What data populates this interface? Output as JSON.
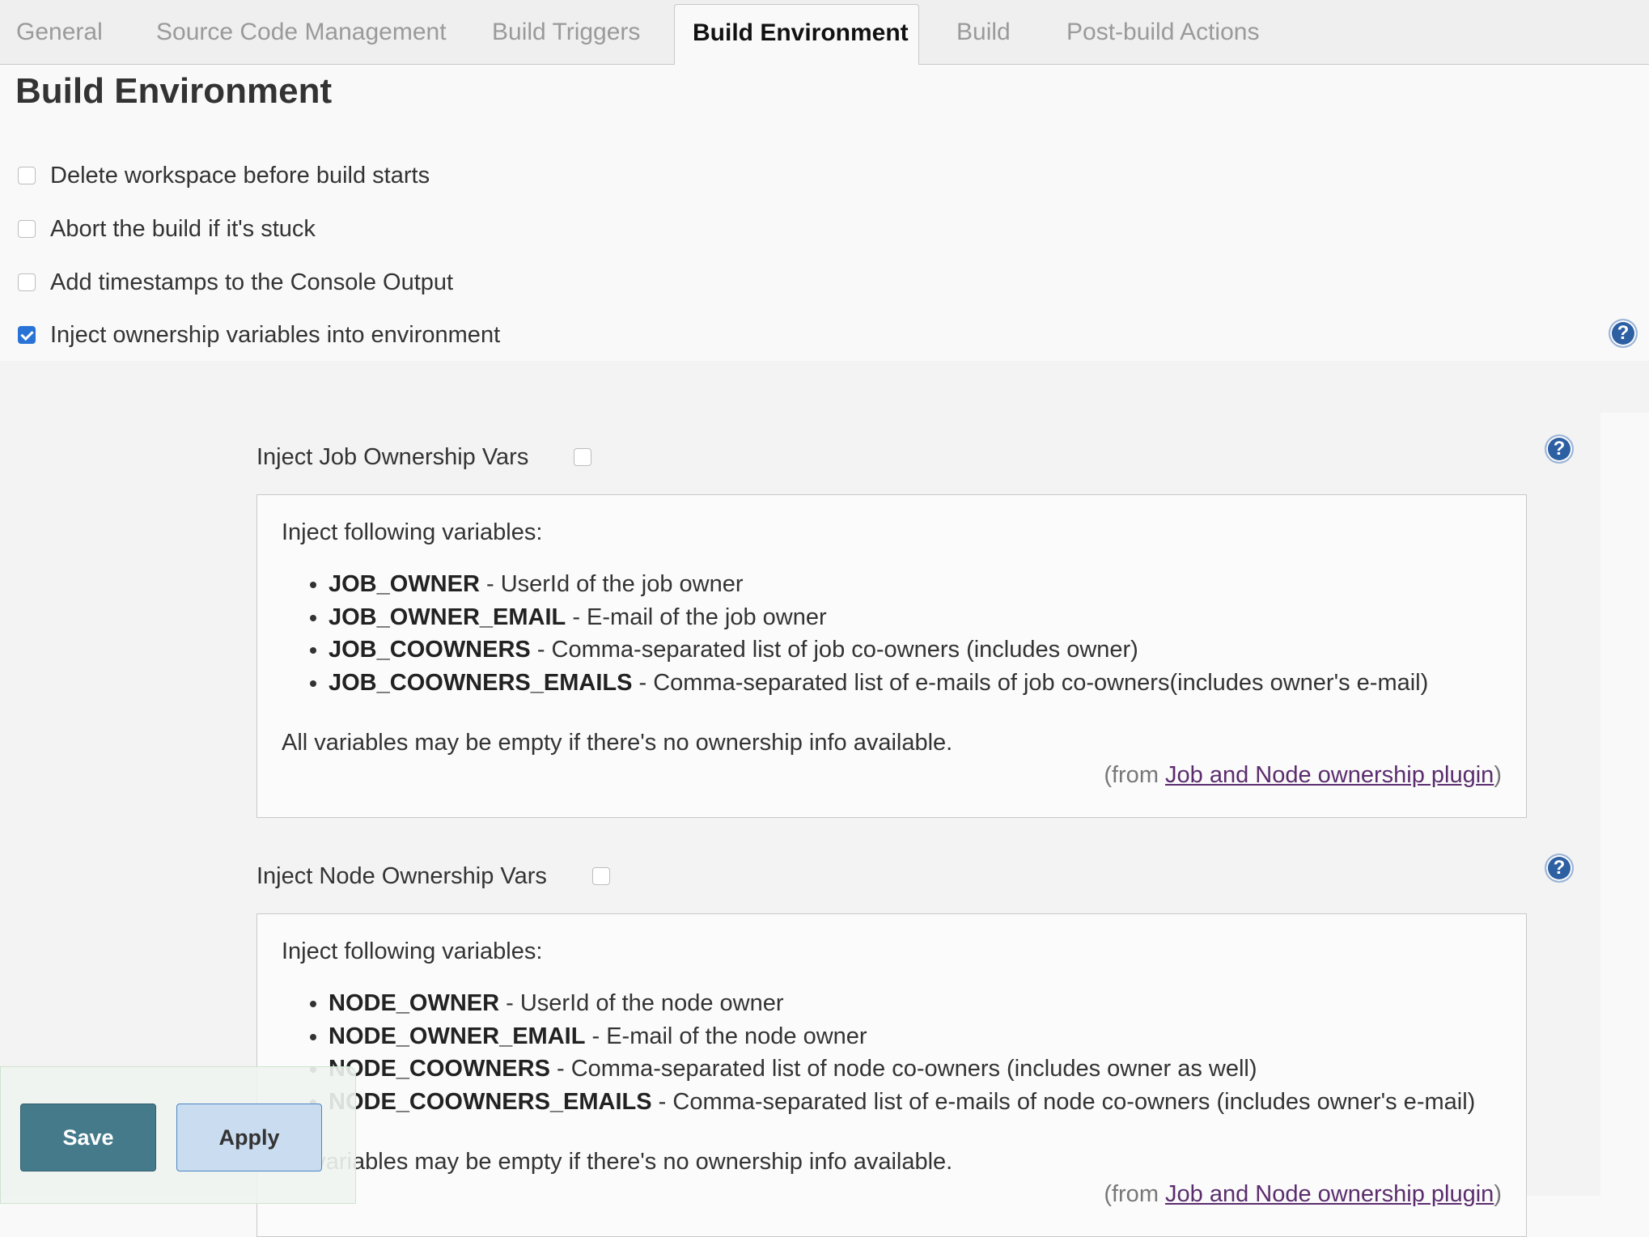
{
  "tabs": [
    {
      "label": "General"
    },
    {
      "label": "Source Code Management"
    },
    {
      "label": "Build Triggers"
    },
    {
      "label": "Build Environment",
      "active": true
    },
    {
      "label": "Build"
    },
    {
      "label": "Post-build Actions"
    }
  ],
  "section_title": "Build Environment",
  "options": [
    {
      "label": "Delete workspace before build starts",
      "checked": false
    },
    {
      "label": "Abort the build if it's stuck",
      "checked": false
    },
    {
      "label": "Add timestamps to the Console Output",
      "checked": false
    },
    {
      "label": "Inject ownership variables into environment",
      "checked": true
    }
  ],
  "job_vars": {
    "label": "Inject Job Ownership Vars",
    "checked": false,
    "intro": "Inject following variables:",
    "items": [
      {
        "name": "JOB_OWNER",
        "desc": " - UserId of the job owner"
      },
      {
        "name": "JOB_OWNER_EMAIL",
        "desc": " - E-mail of the job owner"
      },
      {
        "name": "JOB_COOWNERS",
        "desc": " - Comma-separated list of job co-owners (includes owner)"
      },
      {
        "name": "JOB_COOWNERS_EMAILS",
        "desc": " - Comma-separated list of e-mails of job co-owners(includes owner's e-mail)"
      }
    ],
    "note": "All variables may be empty if there's no ownership info available.",
    "from_prefix": "(from ",
    "from_link": "Job and Node ownership plugin",
    "from_suffix": ")"
  },
  "node_vars": {
    "label": "Inject Node Ownership Vars",
    "checked": false,
    "intro": "Inject following variables:",
    "items": [
      {
        "name": "NODE_OWNER",
        "desc": " - UserId of the node owner"
      },
      {
        "name": "NODE_OWNER_EMAIL",
        "desc": " - E-mail of the node owner"
      },
      {
        "name": "NODE_COOWNERS",
        "desc": " - Comma-separated list of node co-owners (includes owner as well)"
      },
      {
        "name": "NODE_COOWNERS_EMAILS",
        "desc": " - Comma-separated list of e-mails of node co-owners (includes owner's e-mail)"
      }
    ],
    "note": "All variables may be empty if there's no ownership info available.",
    "from_prefix": "(from ",
    "from_link": "Job and Node ownership plugin",
    "from_suffix": ")"
  },
  "help_icon_glyph": "?",
  "buttons": {
    "save": "Save",
    "apply": "Apply"
  },
  "colors": {
    "checkbox_checked": "#2a73d6",
    "save_button": "#457a8b",
    "apply_button": "#c9dcf0",
    "help_icon": "#2d5fa3",
    "link": "#5b2d6e"
  }
}
